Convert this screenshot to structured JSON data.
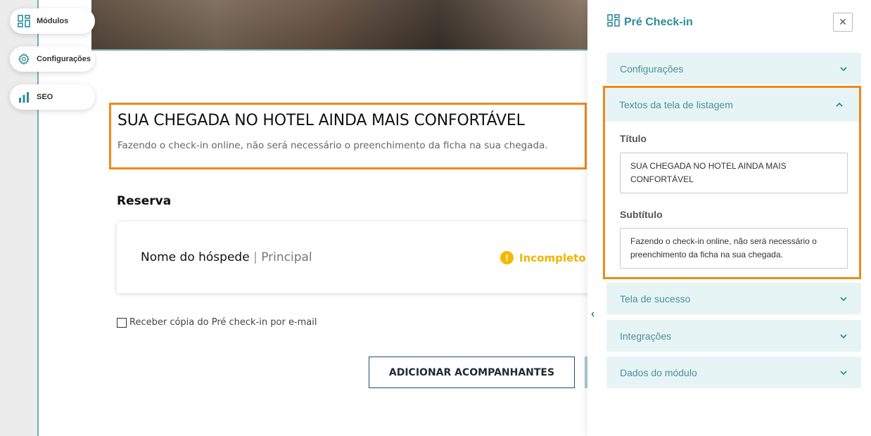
{
  "floating_menu": [
    {
      "label": "Módulos",
      "icon": "grid-icon"
    },
    {
      "label": "Configurações",
      "icon": "gear-icon"
    },
    {
      "label": "SEO",
      "icon": "bar-chart-icon"
    }
  ],
  "preview": {
    "title": "SUA CHEGADA NO HOTEL AINDA MAIS CONFORTÁVEL",
    "subtitle": "Fazendo o check-in online, não será necessário o preenchimento da ficha na sua chegada.",
    "section_title": "Reserva",
    "guest_name": "Nome do hóspede",
    "guest_separator": "|",
    "guest_role": "Principal",
    "status": "Incompleto",
    "copy_checkbox_label": "Receber cópia do Pré check-in por e-mail",
    "add_companions_button": "ADICIONAR ACOMPANHANTES"
  },
  "panel": {
    "title": "Pré Check-in",
    "close_symbol": "✕",
    "sections": [
      {
        "label": "Configurações",
        "expanded": false
      },
      {
        "label": "Textos da tela de listagem",
        "expanded": true
      },
      {
        "label": "Tela de sucesso",
        "expanded": false
      },
      {
        "label": "Integrações",
        "expanded": false
      },
      {
        "label": "Dados do módulo",
        "expanded": false
      }
    ],
    "fields": {
      "title_label": "Título",
      "title_value": "SUA CHEGADA NO HOTEL AINDA MAIS CONFORTÁVEL",
      "subtitle_label": "Subtítulo",
      "subtitle_value": "Fazendo o check-in online, não será necessário o preenchimento da ficha na sua chegada."
    }
  },
  "colors": {
    "accent": "#2d8c99",
    "highlight": "#f0891a",
    "warning": "#f5b800",
    "accordion_bg": "#e6f4f5"
  }
}
